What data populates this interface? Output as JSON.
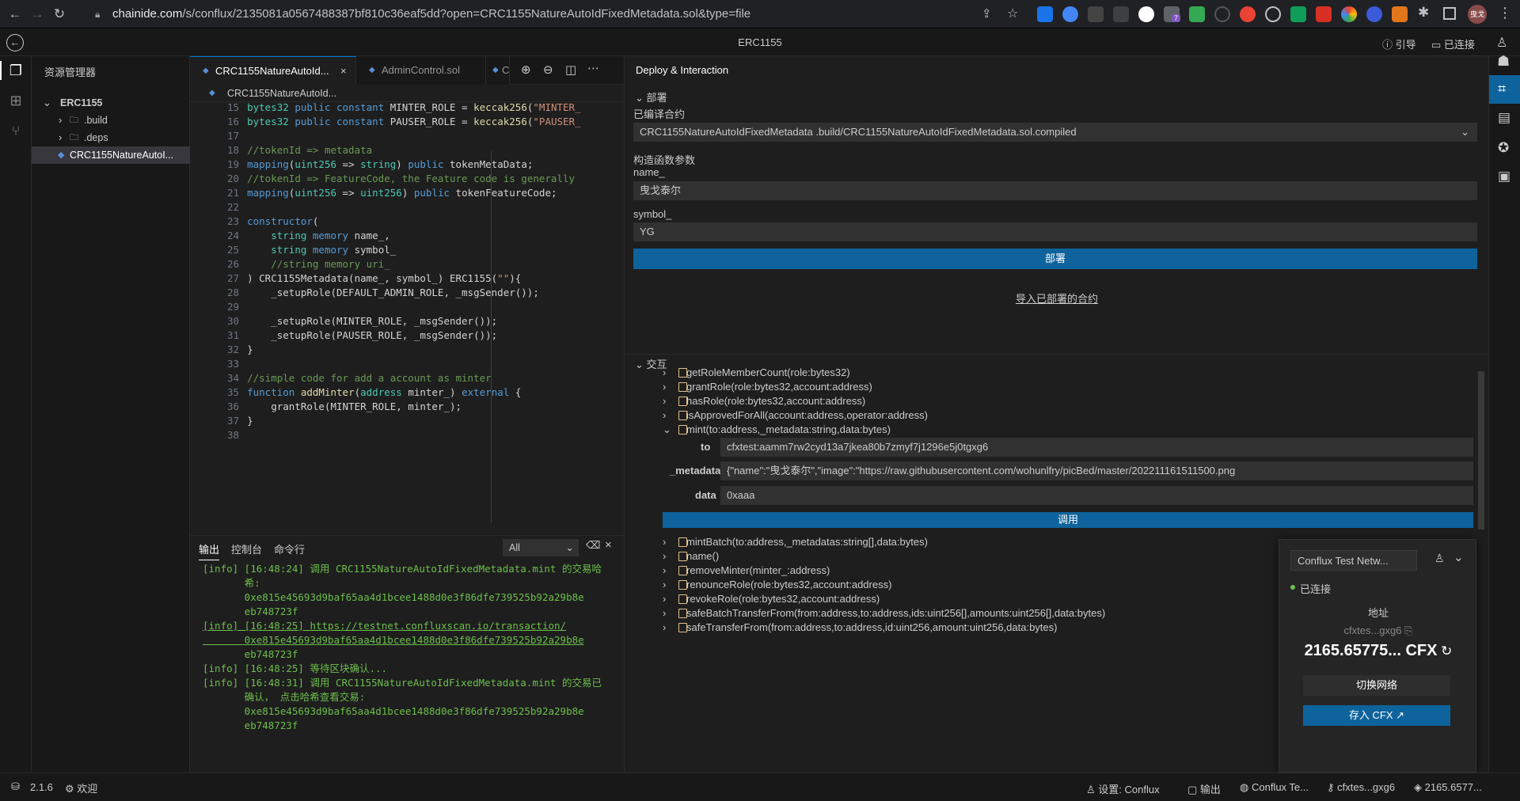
{
  "browser": {
    "url_host": "chainide.com",
    "url_path": "/s/conflux/2135081a0567488387bf810c36eaf5dd?open=CRC1155NatureAutoIdFixedMetadata.sol&type=file",
    "ext_badge": "7",
    "profile": "曳戈"
  },
  "titlebar": {
    "title": "ERC1155",
    "guide": "引导",
    "connected": "已连接"
  },
  "explorer": {
    "header": "资源管理器",
    "root": "ERC1155",
    "items": [
      ".build",
      ".deps",
      "CRC1155NatureAutoI..."
    ]
  },
  "editor": {
    "tabs": [
      "CRC1155NatureAutoId...",
      "AdminControl.sol",
      "C"
    ],
    "breadcrumb": "CRC1155NatureAutoId...",
    "lines": [
      {
        "n": "15",
        "html": "    <span class='ty'>bytes32</span> <span class='kw'>public</span> <span class='kw'>constant</span> MINTER_ROLE = <span class='fn'>keccak256</span>(<span class='st'>\"MINTER_</span>"
      },
      {
        "n": "16",
        "html": "    <span class='ty'>bytes32</span> <span class='kw'>public</span> <span class='kw'>constant</span> PAUSER_ROLE = <span class='fn'>keccak256</span>(<span class='st'>\"PAUSER_</span>"
      },
      {
        "n": "17",
        "html": ""
      },
      {
        "n": "18",
        "html": "    <span class='cm'>//tokenId =&gt; metadata</span>"
      },
      {
        "n": "19",
        "html": "    <span class='kw'>mapping</span>(<span class='ty'>uint256</span> =&gt; <span class='ty'>string</span>) <span class='kw'>public</span> tokenMetaData;"
      },
      {
        "n": "20",
        "html": "    <span class='cm'>//tokenId =&gt; FeatureCode, the Feature code is generally</span>"
      },
      {
        "n": "21",
        "html": "    <span class='kw'>mapping</span>(<span class='ty'>uint256</span> =&gt; <span class='ty'>uint256</span>) <span class='kw'>public</span> tokenFeatureCode;"
      },
      {
        "n": "22",
        "html": ""
      },
      {
        "n": "23",
        "html": "    <span class='kw'>constructor</span>("
      },
      {
        "n": "24",
        "html": "        <span class='ty'>string</span> <span class='kw'>memory</span> name_,"
      },
      {
        "n": "25",
        "html": "        <span class='ty'>string</span> <span class='kw'>memory</span> symbol_"
      },
      {
        "n": "26",
        "html": "        <span class='cm'>//string memory uri_</span>"
      },
      {
        "n": "27",
        "html": "    ) CRC1155Metadata(name_, symbol_) ERC1155(<span class='st'>\"\"</span>){"
      },
      {
        "n": "28",
        "html": "        _setupRole(DEFAULT_ADMIN_ROLE, _msgSender());"
      },
      {
        "n": "29",
        "html": ""
      },
      {
        "n": "30",
        "html": "        _setupRole(MINTER_ROLE, _msgSender());"
      },
      {
        "n": "31",
        "html": "        _setupRole(PAUSER_ROLE, _msgSender());"
      },
      {
        "n": "32",
        "html": "    }"
      },
      {
        "n": "33",
        "html": ""
      },
      {
        "n": "34",
        "html": "    <span class='cm'>//simple code for add a account as minter</span>"
      },
      {
        "n": "35",
        "html": "    <span class='kw'>function</span> <span class='fn'>addMinter</span>(<span class='ty'>address</span> minter_) <span class='kw'>external</span> {"
      },
      {
        "n": "36",
        "html": "        grantRole(MINTER_ROLE, minter_);"
      },
      {
        "n": "37",
        "html": "    }"
      },
      {
        "n": "38",
        "html": ""
      }
    ]
  },
  "panel": {
    "tabs": [
      "输出",
      "控制台",
      "命令行"
    ],
    "filter": "All",
    "logs": [
      "[info] [16:48:24] 调用 CRC1155NatureAutoIdFixedMetadata.mint 的交易哈",
      "       希:",
      "       0xe815e45693d9baf65aa4d1bcee1488d0e3f86dfe739525b92a29b8e",
      "       eb748723f",
      "[info] [16:48:25] https://testnet.confluxscan.io/transaction/",
      "       0xe815e45693d9baf65aa4d1bcee1488d0e3f86dfe739525b92a29b8e",
      "       eb748723f",
      "[info] [16:48:25] 等待区块确认...",
      "[info] [16:48:31] 调用 CRC1155NatureAutoIdFixedMetadata.mint 的交易已",
      "       确认， 点击哈希查看交易:",
      "       0xe815e45693d9baf65aa4d1bcee1488d0e3f86dfe739525b92a29b8e",
      "       eb748723f"
    ]
  },
  "deploy": {
    "header": "Deploy & Interaction",
    "section_deploy": "部署",
    "compiled_label": "已编译合约",
    "compiled_value": "CRC1155NatureAutoIdFixedMetadata .build/CRC1155NatureAutoIdFixedMetadata.sol.compiled",
    "ctor_label": "构造函数参数",
    "name_label": "name_",
    "name_value": "曳戈泰尔",
    "symbol_label": "symbol_",
    "symbol_value": "YG",
    "deploy_button": "部署",
    "import_link": "导入已部署的合约",
    "section_interact": "交互",
    "functions_top": [
      "getRoleMemberCount(role:bytes32)",
      "grantRole(role:bytes32,account:address)",
      "hasRole(role:bytes32,account:address)",
      "isApprovedForAll(account:address,operator:address)",
      "mint(to:address,_metadata:string,data:bytes)"
    ],
    "mint_params": {
      "to_label": "to",
      "to_value": "cfxtest:aamm7rw2cyd13a7jkea80b7zmyf7j1296e5j0tgxg6",
      "metadata_label": "_metadata",
      "metadata_value": "{\"name\":\"曳戈泰尔\",\"image\":\"https://raw.githubusercontent.com/wohunlfry/picBed/master/202211161511500.png",
      "data_label": "data",
      "data_value": "0xaaa",
      "call_button": "调用"
    },
    "functions_bottom": [
      "mintBatch(to:address,_metadatas:string[],data:bytes)",
      "name()",
      "removeMinter(minter_:address)",
      "renounceRole(role:bytes32,account:address)",
      "revokeRole(role:bytes32,account:address)",
      "safeBatchTransferFrom(from:address,to:address,ids:uint256[],amounts:uint256[],data:bytes)",
      "safeTransferFrom(from:address,to:address,id:uint256,amount:uint256,data:bytes)"
    ]
  },
  "wallet": {
    "network": "Conflux Test Netw...",
    "status": "已连接",
    "address_label": "地址",
    "address": "cfxtes...gxg6",
    "balance": "2165.65775... CFX",
    "switch_button": "切换网络",
    "deposit_button": "存入 CFX"
  },
  "statusbar": {
    "version": "2.1.6",
    "welcome": "欢迎",
    "settings": "设置:",
    "settings_value": "Conflux",
    "output": "输出",
    "network": "Conflux Te...",
    "account": "cfxtes...gxg6",
    "balance": "2165.6577..."
  },
  "colors": {
    "accent": "#0e639c",
    "log_green": "#6dbf4b"
  }
}
